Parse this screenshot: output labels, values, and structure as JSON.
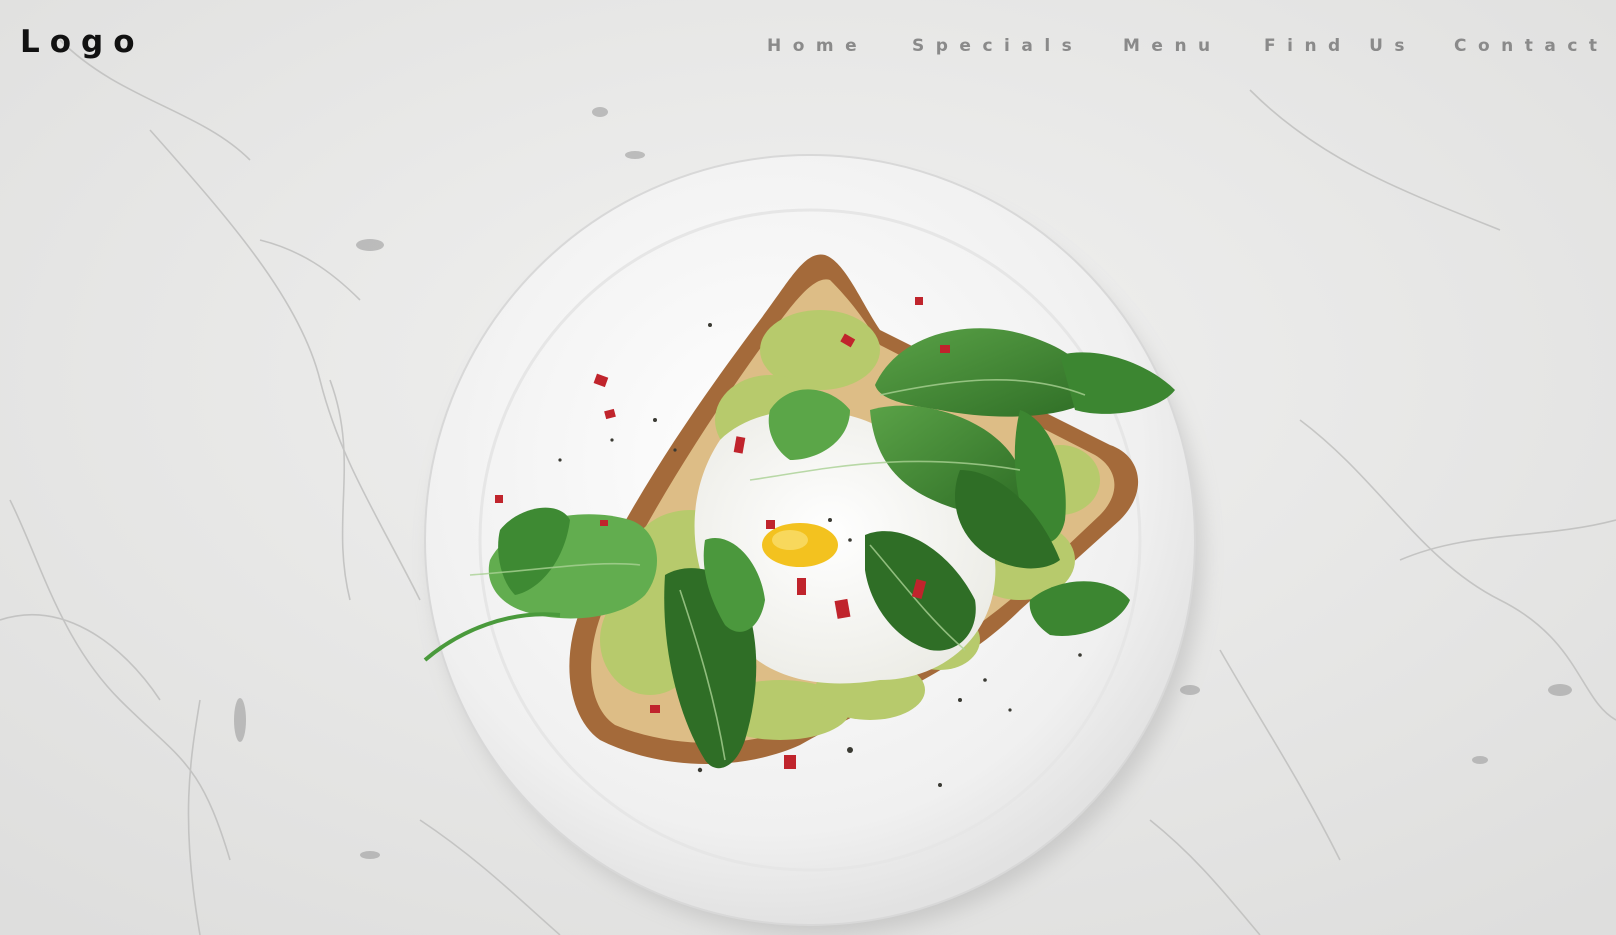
{
  "header": {
    "logo": "Logo",
    "nav": [
      {
        "label": "Home"
      },
      {
        "label": "Specials"
      },
      {
        "label": "Menu"
      },
      {
        "label": "Find Us"
      },
      {
        "label": "Contact"
      }
    ]
  },
  "hero": {
    "image_subject": "poached-egg-avocado-toast-with-spinach-on-plate",
    "colors": {
      "marble": "#e9e9e8",
      "plate": "#f4f4f4",
      "bread_crust": "#8a5530",
      "avocado": "#b5c96a",
      "egg_white": "#fbfbf8",
      "yolk": "#f4c21c",
      "spinach": "#3f8a33",
      "chili_flake": "#c0242c"
    }
  }
}
